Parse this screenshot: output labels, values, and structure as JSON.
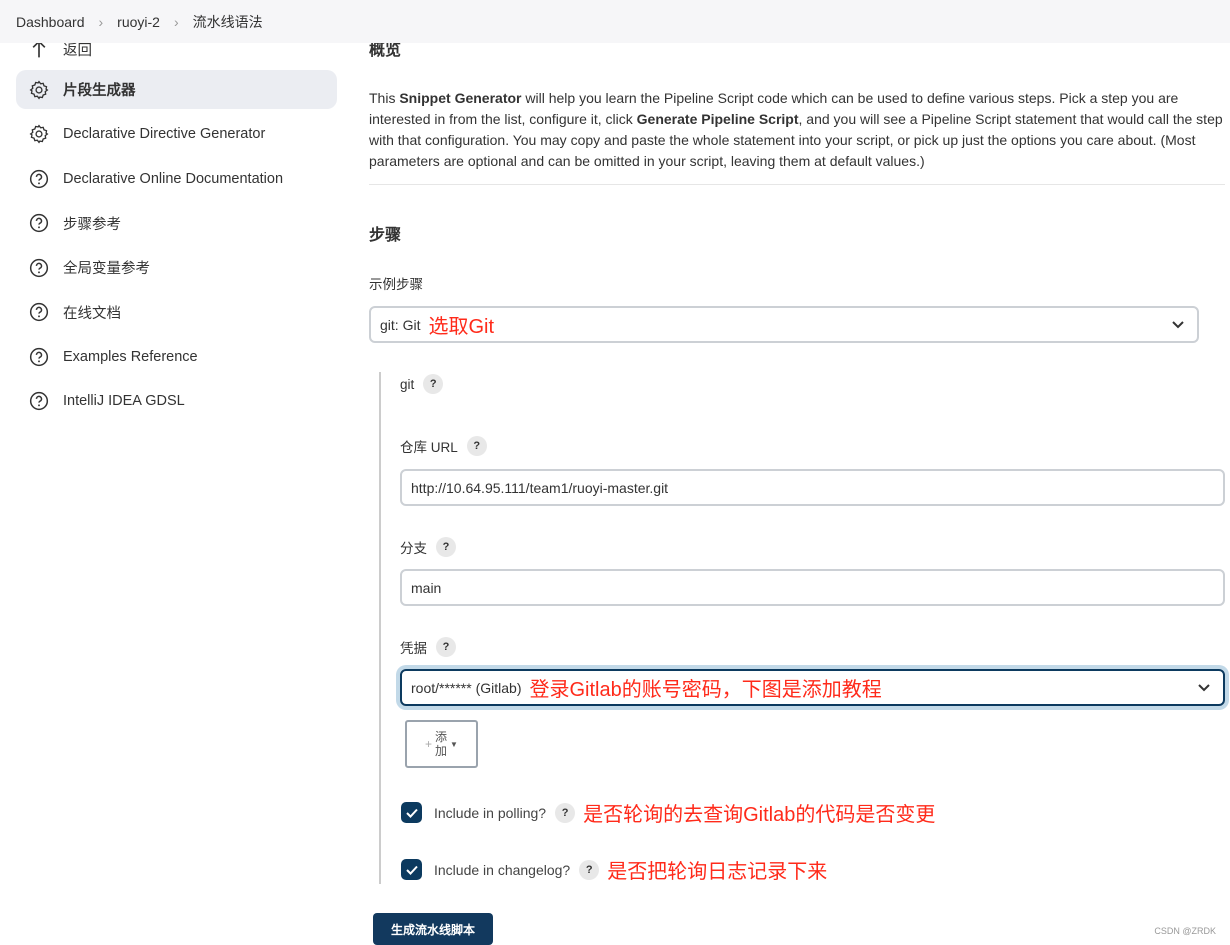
{
  "breadcrumb": [
    "Dashboard",
    "ruoyi-2",
    "流水线语法"
  ],
  "sidebar": {
    "items": [
      {
        "label": "返回",
        "icon": "arrow-up-icon"
      },
      {
        "label": "片段生成器",
        "icon": "gear-icon",
        "active": true
      },
      {
        "label": "Declarative Directive Generator",
        "icon": "gear-icon"
      },
      {
        "label": "Declarative Online Documentation",
        "icon": "help-icon"
      },
      {
        "label": "步骤参考",
        "icon": "help-icon"
      },
      {
        "label": "全局变量参考",
        "icon": "help-icon"
      },
      {
        "label": "在线文档",
        "icon": "help-icon"
      },
      {
        "label": "Examples Reference",
        "icon": "help-icon"
      },
      {
        "label": "IntelliJ IDEA GDSL",
        "icon": "help-icon"
      }
    ]
  },
  "main": {
    "overview_title": "概览",
    "desc": {
      "p1": "This ",
      "b1": "Snippet Generator",
      "p2": " will help you learn the Pipeline Script code which can be used to define various steps. Pick a step you are interested in from the list, configure it, click ",
      "b2": "Generate Pipeline Script",
      "p3": ", and you will see a Pipeline Script statement that would call the step with that configuration. You may copy and paste the whole statement into your script, or pick up just the options you care about. (Most parameters are optional and can be omitted in your script, leaving them at default values.)"
    },
    "steps_title": "步骤",
    "sample_step_label": "示例步骤",
    "sample_step_value": "git: Git",
    "sample_step_note": "选取Git",
    "git_label": "git",
    "repo_label": "仓库 URL",
    "repo_value": "http://10.64.95.111/team1/ruoyi-master.git",
    "branch_label": "分支",
    "branch_value": "main",
    "cred_label": "凭据",
    "cred_value": "root/****** (Gitlab)",
    "cred_note": "登录Gitlab的账号密码，下图是添加教程",
    "add_label_1": "添",
    "add_label_2": "加",
    "polling_label": "Include in polling?",
    "polling_checked": true,
    "polling_note": "是否轮询的去查询Gitlab的代码是否变更",
    "changelog_label": "Include in changelog?",
    "changelog_checked": true,
    "changelog_note": "是否把轮询日志记录下来",
    "generate_button": "生成流水线脚本",
    "help": "?"
  },
  "watermark": "CSDN @ZRDK",
  "colors": {
    "primary": "#12395e",
    "annotation": "#ff2a1a"
  }
}
